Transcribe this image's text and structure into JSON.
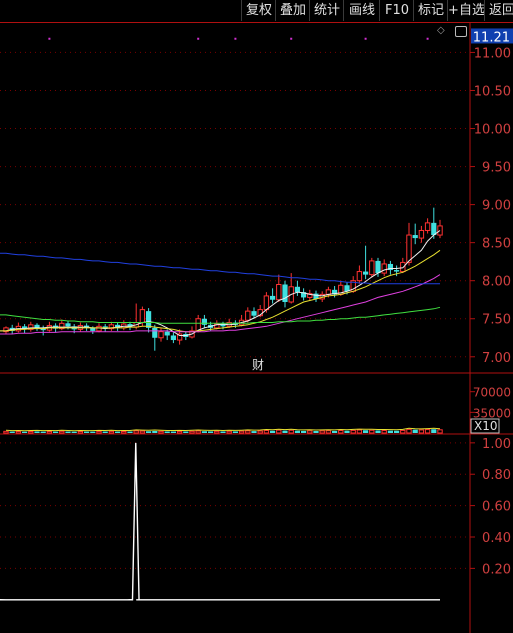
{
  "toolbar": {
    "buttons": [
      "复权",
      "叠加",
      "统计",
      "画线",
      "F10",
      "标记",
      "+自选",
      "返回"
    ]
  },
  "chart_data": [
    {
      "type": "candlestick",
      "panel": "price",
      "current_price_label": "11.21",
      "y_ticks": [
        "11.00",
        "10.50",
        "10.00",
        "9.50",
        "9.00",
        "8.50",
        "8.00",
        "7.50",
        "7.00"
      ],
      "ylim": [
        6.8,
        11.4
      ],
      "annotation": "财",
      "candles": [
        [
          7.33,
          7.38,
          7.4,
          7.3
        ],
        [
          7.38,
          7.34,
          7.42,
          7.3
        ],
        [
          7.34,
          7.4,
          7.45,
          7.32
        ],
        [
          7.4,
          7.36,
          7.43,
          7.31
        ],
        [
          7.36,
          7.42,
          7.46,
          7.33
        ],
        [
          7.42,
          7.38,
          7.44,
          7.34
        ],
        [
          7.38,
          7.35,
          7.41,
          7.28
        ],
        [
          7.35,
          7.41,
          7.46,
          7.33
        ],
        [
          7.41,
          7.37,
          7.44,
          7.32
        ],
        [
          7.37,
          7.44,
          7.49,
          7.35
        ],
        [
          7.44,
          7.4,
          7.47,
          7.36
        ],
        [
          7.4,
          7.36,
          7.43,
          7.31
        ],
        [
          7.36,
          7.41,
          7.45,
          7.33
        ],
        [
          7.41,
          7.38,
          7.44,
          7.34
        ],
        [
          7.38,
          7.34,
          7.4,
          7.3
        ],
        [
          7.34,
          7.4,
          7.44,
          7.32
        ],
        [
          7.4,
          7.37,
          7.43,
          7.33
        ],
        [
          7.37,
          7.42,
          7.46,
          7.34
        ],
        [
          7.42,
          7.38,
          7.45,
          7.34
        ],
        [
          7.38,
          7.43,
          7.48,
          7.35
        ],
        [
          7.43,
          7.39,
          7.46,
          7.35
        ],
        [
          7.39,
          7.45,
          7.7,
          7.36
        ],
        [
          7.45,
          7.62,
          7.66,
          7.4
        ],
        [
          7.6,
          7.38,
          7.64,
          7.32
        ],
        [
          7.38,
          7.25,
          7.42,
          7.08
        ],
        [
          7.25,
          7.33,
          7.38,
          7.2
        ],
        [
          7.33,
          7.28,
          7.36,
          7.22
        ],
        [
          7.28,
          7.22,
          7.32,
          7.18
        ],
        [
          7.22,
          7.3,
          7.36,
          7.16
        ],
        [
          7.3,
          7.26,
          7.33,
          7.22
        ],
        [
          7.26,
          7.34,
          7.4,
          7.24
        ],
        [
          7.34,
          7.5,
          7.55,
          7.32
        ],
        [
          7.5,
          7.42,
          7.55,
          7.38
        ],
        [
          7.42,
          7.38,
          7.46,
          7.34
        ],
        [
          7.38,
          7.43,
          7.48,
          7.36
        ],
        [
          7.43,
          7.4,
          7.46,
          7.36
        ],
        [
          7.4,
          7.45,
          7.5,
          7.38
        ],
        [
          7.45,
          7.42,
          7.48,
          7.38
        ],
        [
          7.42,
          7.48,
          7.55,
          7.4
        ],
        [
          7.48,
          7.6,
          7.65,
          7.45
        ],
        [
          7.6,
          7.54,
          7.65,
          7.5
        ],
        [
          7.54,
          7.62,
          7.68,
          7.52
        ],
        [
          7.62,
          7.8,
          7.85,
          7.58
        ],
        [
          7.8,
          7.75,
          7.9,
          7.7
        ],
        [
          7.75,
          7.95,
          8.08,
          7.72
        ],
        [
          7.95,
          7.72,
          8.0,
          7.65
        ],
        [
          7.72,
          7.92,
          8.1,
          7.7
        ],
        [
          7.92,
          7.85,
          8.0,
          7.8
        ],
        [
          7.85,
          7.78,
          7.9,
          7.74
        ],
        [
          7.78,
          7.83,
          7.88,
          7.74
        ],
        [
          7.83,
          7.76,
          7.87,
          7.72
        ],
        [
          7.76,
          7.82,
          7.86,
          7.72
        ],
        [
          7.82,
          7.88,
          7.92,
          7.78
        ],
        [
          7.88,
          7.82,
          7.93,
          7.78
        ],
        [
          7.82,
          7.94,
          8.0,
          7.8
        ],
        [
          7.94,
          7.86,
          7.98,
          7.82
        ],
        [
          7.86,
          8.0,
          8.06,
          7.84
        ],
        [
          8.0,
          8.12,
          8.2,
          7.96
        ],
        [
          8.12,
          8.08,
          8.46,
          8.02
        ],
        [
          8.08,
          8.26,
          8.3,
          8.04
        ],
        [
          8.26,
          8.1,
          8.3,
          8.05
        ],
        [
          8.1,
          8.22,
          8.28,
          8.06
        ],
        [
          8.22,
          8.14,
          8.26,
          8.08
        ],
        [
          8.14,
          8.12,
          8.2,
          8.06
        ],
        [
          8.12,
          8.24,
          8.3,
          8.1
        ],
        [
          8.24,
          8.6,
          8.76,
          8.2
        ],
        [
          8.6,
          8.56,
          8.75,
          8.48
        ],
        [
          8.56,
          8.66,
          8.72,
          8.5
        ],
        [
          8.66,
          8.76,
          8.82,
          8.62
        ],
        [
          8.76,
          8.6,
          8.96,
          8.55
        ],
        [
          8.6,
          8.72,
          8.8,
          8.56
        ]
      ],
      "moving_averages": [
        {
          "color": "#f0f0f0",
          "values": [
            7.34,
            7.36,
            7.37,
            7.37,
            7.38,
            7.38,
            7.38,
            7.39,
            7.39,
            7.39,
            7.39,
            7.39,
            7.39,
            7.39,
            7.38,
            7.38,
            7.37,
            7.38,
            7.39,
            7.4,
            7.4,
            7.42,
            7.45,
            7.46,
            7.45,
            7.42,
            7.38,
            7.33,
            7.28,
            7.28,
            7.3,
            7.35,
            7.38,
            7.4,
            7.42,
            7.43,
            7.42,
            7.43,
            7.45,
            7.47,
            7.51,
            7.55,
            7.62,
            7.68,
            7.74,
            7.77,
            7.82,
            7.85,
            7.84,
            7.82,
            7.81,
            7.8,
            7.82,
            7.83,
            7.84,
            7.86,
            7.89,
            7.94,
            7.99,
            8.05,
            8.1,
            8.14,
            8.16,
            8.16,
            8.17,
            8.26,
            8.33,
            8.4,
            8.52,
            8.6,
            8.66
          ]
        },
        {
          "color": "#e8e030",
          "values": [
            7.34,
            7.35,
            7.36,
            7.36,
            7.37,
            7.37,
            7.37,
            7.38,
            7.38,
            7.38,
            7.38,
            7.38,
            7.38,
            7.38,
            7.38,
            7.38,
            7.38,
            7.38,
            7.38,
            7.38,
            7.39,
            7.39,
            7.4,
            7.4,
            7.39,
            7.38,
            7.37,
            7.36,
            7.34,
            7.33,
            7.33,
            7.34,
            7.35,
            7.36,
            7.37,
            7.38,
            7.39,
            7.4,
            7.41,
            7.42,
            7.44,
            7.46,
            7.49,
            7.52,
            7.56,
            7.6,
            7.64,
            7.68,
            7.72,
            7.74,
            7.76,
            7.78,
            7.8,
            7.81,
            7.82,
            7.84,
            7.86,
            7.89,
            7.92,
            7.96,
            8.0,
            8.04,
            8.07,
            8.09,
            8.11,
            8.15,
            8.19,
            8.24,
            8.29,
            8.34,
            8.4
          ]
        },
        {
          "color": "#e040e0",
          "values": [
            7.3,
            7.3,
            7.31,
            7.31,
            7.31,
            7.32,
            7.32,
            7.32,
            7.32,
            7.33,
            7.33,
            7.33,
            7.33,
            7.33,
            7.33,
            7.33,
            7.33,
            7.33,
            7.33,
            7.33,
            7.33,
            7.34,
            7.34,
            7.34,
            7.34,
            7.34,
            7.34,
            7.33,
            7.33,
            7.33,
            7.33,
            7.33,
            7.33,
            7.34,
            7.34,
            7.34,
            7.35,
            7.35,
            7.36,
            7.37,
            7.38,
            7.39,
            7.4,
            7.42,
            7.44,
            7.46,
            7.48,
            7.5,
            7.52,
            7.54,
            7.56,
            7.58,
            7.6,
            7.62,
            7.64,
            7.66,
            7.68,
            7.7,
            7.72,
            7.75,
            7.78,
            7.8,
            7.82,
            7.84,
            7.86,
            7.89,
            7.92,
            7.95,
            7.99,
            8.03,
            8.08
          ]
        },
        {
          "color": "#40e040",
          "values": [
            7.55,
            7.54,
            7.53,
            7.52,
            7.51,
            7.5,
            7.49,
            7.49,
            7.48,
            7.48,
            7.47,
            7.47,
            7.46,
            7.46,
            7.46,
            7.45,
            7.45,
            7.45,
            7.45,
            7.45,
            7.45,
            7.45,
            7.45,
            7.45,
            7.45,
            7.44,
            7.44,
            7.44,
            7.44,
            7.44,
            7.44,
            7.44,
            7.44,
            7.44,
            7.44,
            7.44,
            7.44,
            7.44,
            7.44,
            7.44,
            7.45,
            7.45,
            7.45,
            7.45,
            7.46,
            7.46,
            7.46,
            7.47,
            7.47,
            7.47,
            7.48,
            7.48,
            7.49,
            7.49,
            7.5,
            7.5,
            7.51,
            7.52,
            7.52,
            7.53,
            7.54,
            7.55,
            7.56,
            7.57,
            7.58,
            7.59,
            7.6,
            7.61,
            7.62,
            7.63,
            7.65
          ]
        },
        {
          "color": "#2040e0",
          "values": [
            8.36,
            8.35,
            8.34,
            8.34,
            8.33,
            8.32,
            8.32,
            8.31,
            8.3,
            8.3,
            8.29,
            8.28,
            8.28,
            8.27,
            8.26,
            8.26,
            8.25,
            8.24,
            8.24,
            8.23,
            8.22,
            8.22,
            8.21,
            8.2,
            8.19,
            8.19,
            8.18,
            8.17,
            8.17,
            8.16,
            8.15,
            8.15,
            8.14,
            8.13,
            8.13,
            8.12,
            8.11,
            8.11,
            8.1,
            8.09,
            8.09,
            8.08,
            8.07,
            8.06,
            8.06,
            8.05,
            8.04,
            8.04,
            8.03,
            8.02,
            8.02,
            8.01,
            8.0,
            8.0,
            7.99,
            7.98,
            7.98,
            7.97,
            7.97,
            7.96,
            7.96,
            7.96,
            7.96,
            7.96,
            7.96,
            7.96,
            7.96,
            7.96,
            7.96,
            7.96,
            7.96
          ]
        }
      ],
      "markers": [
        {
          "index": 7,
          "y": 11.18
        },
        {
          "index": 31,
          "y": 11.18
        },
        {
          "index": 37,
          "y": 11.18
        },
        {
          "index": 46,
          "y": 11.18
        },
        {
          "index": 58,
          "y": 11.18
        },
        {
          "index": 68,
          "y": 11.18
        }
      ]
    },
    {
      "type": "bar",
      "panel": "volume",
      "y_ticks": [
        "70000",
        "35000"
      ],
      "multiplier_label": "X10",
      "ylim": [
        0,
        100000
      ],
      "values": [
        2800,
        2400,
        2600,
        2200,
        2500,
        2700,
        2300,
        2600,
        2400,
        2900,
        2500,
        2200,
        2600,
        2400,
        2300,
        2700,
        2500,
        2800,
        2400,
        2600,
        2500,
        3600,
        3200,
        3000,
        3400,
        2800,
        2600,
        2500,
        2700,
        2600,
        2900,
        3400,
        3000,
        2700,
        2800,
        2600,
        2900,
        2700,
        3100,
        3600,
        3200,
        3400,
        4200,
        3800,
        4800,
        4000,
        4600,
        3900,
        3500,
        3700,
        3400,
        3600,
        3900,
        3500,
        4200,
        3800,
        4400,
        5000,
        4700,
        4600,
        4300,
        4200,
        4000,
        3800,
        4400,
        6200,
        5600,
        5200,
        5800,
        6400,
        5400
      ]
    },
    {
      "type": "line",
      "panel": "indicator",
      "y_ticks": [
        "1.00",
        "0.80",
        "0.60",
        "0.40",
        "0.20"
      ],
      "ylim": [
        -0.18,
        1.05
      ],
      "values": [
        0,
        0,
        0,
        0,
        0,
        0,
        0,
        0,
        0,
        0,
        0,
        0,
        0,
        0,
        0,
        0,
        0,
        0,
        0,
        0,
        0,
        0,
        0,
        0,
        0,
        0,
        0,
        0,
        0,
        0,
        0,
        0,
        0,
        0,
        0,
        0,
        0,
        0,
        0,
        0,
        0,
        0,
        0,
        0,
        0,
        0,
        0,
        0,
        0,
        0,
        0,
        0,
        0,
        0,
        0,
        0,
        0,
        0,
        0,
        0,
        0,
        0,
        0,
        0,
        0,
        0,
        0,
        0,
        0,
        0,
        0
      ],
      "spike": {
        "x_from": 0.4,
        "x_peak": 0.8,
        "x_to": 1.2,
        "peak": 1.0
      }
    }
  ]
}
